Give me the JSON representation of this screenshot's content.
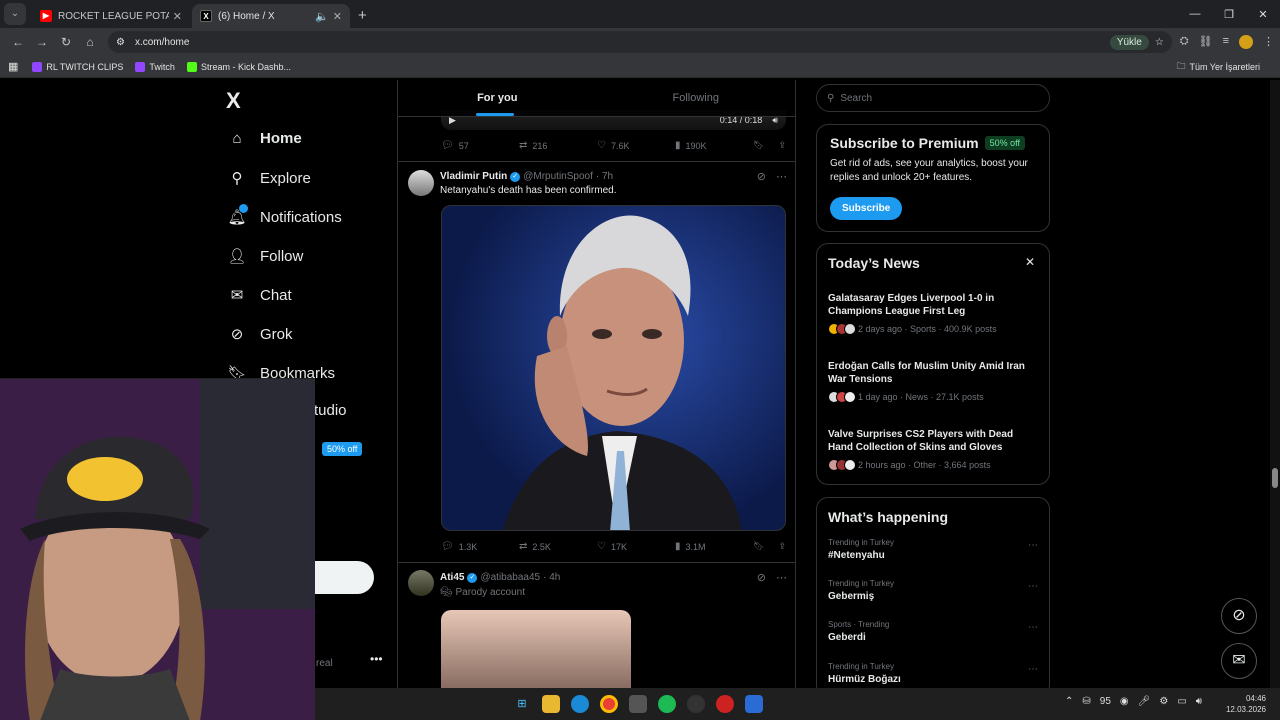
{
  "browser": {
    "tabs": [
      {
        "title": "ROCKET LEAGUE POTATO MOMENTS",
        "active": false
      },
      {
        "title": "(6) Home / X",
        "active": true
      }
    ],
    "new_tab": "+",
    "url": "x.com/home",
    "upload_label": "Yükle",
    "bookmarks": [
      "RL TWITCH CLIPS",
      "Twitch",
      "Stream - Kick Dashb..."
    ],
    "all_bookmarks": "Tüm Yer İşaretleri"
  },
  "sidebar": {
    "logo": "X",
    "items": [
      {
        "label": "Home",
        "icon": "home-icon"
      },
      {
        "label": "Explore",
        "icon": "search-icon"
      },
      {
        "label": "Notifications",
        "icon": "bell-icon"
      },
      {
        "label": "Follow",
        "icon": "person-add-icon"
      },
      {
        "label": "Chat",
        "icon": "mail-icon"
      },
      {
        "label": "Grok",
        "icon": "grok-icon"
      },
      {
        "label": "Bookmarks",
        "icon": "bookmark-icon"
      },
      {
        "label": "tudio",
        "icon": ""
      }
    ],
    "premium_badge": "50% off",
    "account_snippet": "real"
  },
  "feed": {
    "tabs": [
      "For you",
      "Following"
    ],
    "video_time": "0:14 / 0:18",
    "prev_tweet_stats": {
      "replies": "57",
      "reposts": "216",
      "likes": "7.6K",
      "views": "190K"
    },
    "tweet1": {
      "name": "Vladimir Putin",
      "handle": "@MrputinSpoof",
      "time": "· 7h",
      "text": "Netanyahu's death has been confirmed.",
      "stats": {
        "replies": "1.3K",
        "reposts": "2.5K",
        "likes": "17K",
        "views": "3.1M"
      }
    },
    "tweet2": {
      "name": "Ati45",
      "handle": "@atibabaa45",
      "time": "· 4h",
      "text": "Parody account"
    }
  },
  "right": {
    "search_placeholder": "Search",
    "premium": {
      "title": "Subscribe to Premium",
      "badge": "50% off",
      "body": "Get rid of ads, see your analytics, boost your replies and unlock 20+ features.",
      "button": "Subscribe"
    },
    "news": {
      "title": "Today’s News",
      "items": [
        {
          "headline": "Galatasaray Edges Liverpool 1-0 in Champions League First Leg",
          "meta": "2 days ago · Sports · 400.9K posts"
        },
        {
          "headline": "Erdoğan Calls for Muslim Unity Amid Iran War Tensions",
          "meta": "1 day ago · News · 27.1K posts"
        },
        {
          "headline": "Valve Surprises CS2 Players with Dead Hand Collection of Skins and Gloves",
          "meta": "2 hours ago · Other · 3,664 posts"
        }
      ]
    },
    "happening": {
      "title": "What’s happening",
      "trends": [
        {
          "context": "Trending in Turkey",
          "topic": "#Netenyahu"
        },
        {
          "context": "Trending in Turkey",
          "topic": "Gebermiş"
        },
        {
          "context": "Sports · Trending",
          "topic": "Geberdi"
        },
        {
          "context": "Trending in Turkey",
          "topic": "Hürmüz Boğazı"
        }
      ]
    }
  },
  "taskbar": {
    "tray_number": "95",
    "time": "04:46",
    "date": "12.03.2026"
  },
  "colors": {
    "accent": "#1d9bf0",
    "background": "#000000",
    "border": "#2f3336",
    "muted": "#71767b"
  }
}
